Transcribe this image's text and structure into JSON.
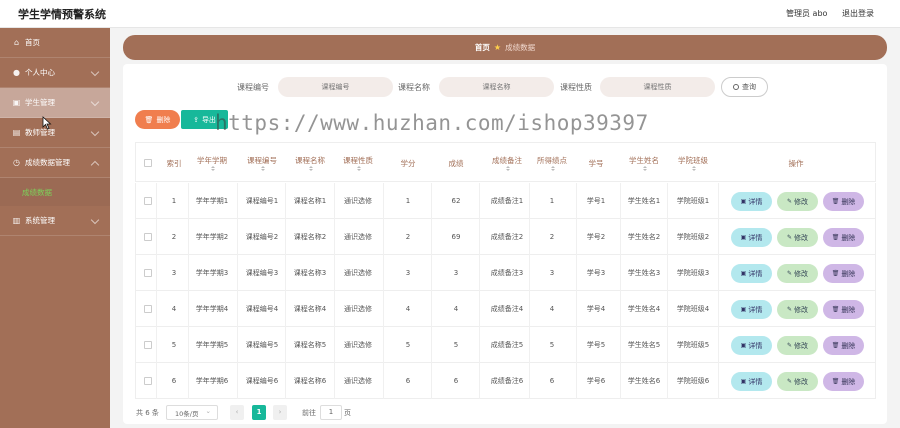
{
  "header": {
    "title": "学生学情预警系统",
    "admin": "管理员 abo",
    "logout": "退出登录"
  },
  "sidebar": {
    "items": [
      {
        "label": "首页"
      },
      {
        "label": "个人中心"
      },
      {
        "label": "学生管理"
      },
      {
        "label": "教师管理"
      },
      {
        "label": "成绩数据管理"
      },
      {
        "label": "成绩数据"
      },
      {
        "label": "系统管理"
      }
    ]
  },
  "breadcrumb": {
    "home": "首页",
    "current": "成绩数据"
  },
  "search": {
    "course_no_label": "课程编号",
    "course_no_placeholder": "课程编号",
    "course_name_label": "课程名称",
    "course_name_placeholder": "课程名称",
    "course_type_label": "课程性质",
    "course_type_placeholder": "课程性质",
    "button": "查询"
  },
  "toolbar": {
    "delete": "删除",
    "export": "导出"
  },
  "watermark": "https://www.huzhan.com/ishop39397",
  "table": {
    "columns": [
      "索引",
      "学年学期",
      "课程编号",
      "课程名称",
      "课程性质",
      "学分",
      "成绩",
      "成绩备注",
      "所得绩点",
      "学号",
      "学生姓名",
      "学院班级",
      "操作"
    ],
    "actions": {
      "detail": "详情",
      "edit": "修改",
      "delete": "删除"
    },
    "rows": [
      [
        "1",
        "学年学期1",
        "课程编号1",
        "课程名称1",
        "通识选修",
        "1",
        "62",
        "成绩备注1",
        "1",
        "学号1",
        "学生姓名1",
        "学院班级1"
      ],
      [
        "2",
        "学年学期2",
        "课程编号2",
        "课程名称2",
        "通识选修",
        "2",
        "69",
        "成绩备注2",
        "2",
        "学号2",
        "学生姓名2",
        "学院班级2"
      ],
      [
        "3",
        "学年学期3",
        "课程编号3",
        "课程名称3",
        "通识选修",
        "3",
        "3",
        "成绩备注3",
        "3",
        "学号3",
        "学生姓名3",
        "学院班级3"
      ],
      [
        "4",
        "学年学期4",
        "课程编号4",
        "课程名称4",
        "通识选修",
        "4",
        "4",
        "成绩备注4",
        "4",
        "学号4",
        "学生姓名4",
        "学院班级4"
      ],
      [
        "5",
        "学年学期5",
        "课程编号5",
        "课程名称5",
        "通识选修",
        "5",
        "5",
        "成绩备注5",
        "5",
        "学号5",
        "学生姓名5",
        "学院班级5"
      ],
      [
        "6",
        "学年学期6",
        "课程编号6",
        "课程名称6",
        "通识选修",
        "6",
        "6",
        "成绩备注6",
        "6",
        "学号6",
        "学生姓名6",
        "学院班级6"
      ]
    ]
  },
  "pagination": {
    "total": "共 6 条",
    "page_size": "10条/页",
    "current": "1",
    "goto_label": "前往",
    "goto_value": "1",
    "page_suffix": "页"
  },
  "colors": {
    "brand": "#a26f57",
    "accent": "#17b89a",
    "danger": "#f07e4e"
  }
}
